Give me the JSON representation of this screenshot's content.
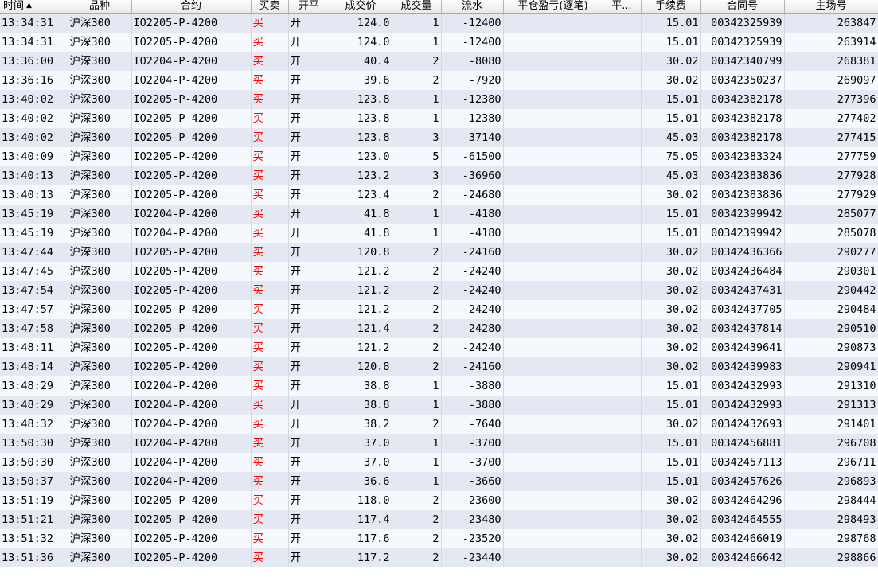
{
  "columns": [
    {
      "key": "time",
      "label": "时间",
      "sort_icon": "▲"
    },
    {
      "key": "product",
      "label": "品种"
    },
    {
      "key": "contract",
      "label": "合约"
    },
    {
      "key": "side",
      "label": "买卖"
    },
    {
      "key": "openclose",
      "label": "开平"
    },
    {
      "key": "price",
      "label": "成交价"
    },
    {
      "key": "volume",
      "label": "成交量"
    },
    {
      "key": "cash",
      "label": "流水"
    },
    {
      "key": "pnl",
      "label": "平仓盈亏(逐笔)"
    },
    {
      "key": "ph",
      "label": "平..."
    },
    {
      "key": "fee",
      "label": "手续费"
    },
    {
      "key": "order",
      "label": "合同号"
    },
    {
      "key": "deal",
      "label": "主场号"
    }
  ],
  "colors": {
    "buy": "#ff0000",
    "cashflow_negative": "#008a00",
    "row_odd": "#e4e8f3",
    "row_even": "#f5f8fd"
  },
  "rows": [
    {
      "time": "13:34:31",
      "product": "沪深300",
      "contract": "IO2205-P-4200",
      "side": "买",
      "openclose": "开",
      "price": "124.0",
      "volume": "1",
      "cash": "-12400",
      "pnl": "",
      "ph": "",
      "fee": "15.01",
      "order": "00342325939",
      "deal": "263847"
    },
    {
      "time": "13:34:31",
      "product": "沪深300",
      "contract": "IO2205-P-4200",
      "side": "买",
      "openclose": "开",
      "price": "124.0",
      "volume": "1",
      "cash": "-12400",
      "pnl": "",
      "ph": "",
      "fee": "15.01",
      "order": "00342325939",
      "deal": "263914"
    },
    {
      "time": "13:36:00",
      "product": "沪深300",
      "contract": "IO2204-P-4200",
      "side": "买",
      "openclose": "开",
      "price": "40.4",
      "volume": "2",
      "cash": "-8080",
      "pnl": "",
      "ph": "",
      "fee": "30.02",
      "order": "00342340799",
      "deal": "268381"
    },
    {
      "time": "13:36:16",
      "product": "沪深300",
      "contract": "IO2204-P-4200",
      "side": "买",
      "openclose": "开",
      "price": "39.6",
      "volume": "2",
      "cash": "-7920",
      "pnl": "",
      "ph": "",
      "fee": "30.02",
      "order": "00342350237",
      "deal": "269097"
    },
    {
      "time": "13:40:02",
      "product": "沪深300",
      "contract": "IO2205-P-4200",
      "side": "买",
      "openclose": "开",
      "price": "123.8",
      "volume": "1",
      "cash": "-12380",
      "pnl": "",
      "ph": "",
      "fee": "15.01",
      "order": "00342382178",
      "deal": "277396"
    },
    {
      "time": "13:40:02",
      "product": "沪深300",
      "contract": "IO2205-P-4200",
      "side": "买",
      "openclose": "开",
      "price": "123.8",
      "volume": "1",
      "cash": "-12380",
      "pnl": "",
      "ph": "",
      "fee": "15.01",
      "order": "00342382178",
      "deal": "277402"
    },
    {
      "time": "13:40:02",
      "product": "沪深300",
      "contract": "IO2205-P-4200",
      "side": "买",
      "openclose": "开",
      "price": "123.8",
      "volume": "3",
      "cash": "-37140",
      "pnl": "",
      "ph": "",
      "fee": "45.03",
      "order": "00342382178",
      "deal": "277415"
    },
    {
      "time": "13:40:09",
      "product": "沪深300",
      "contract": "IO2205-P-4200",
      "side": "买",
      "openclose": "开",
      "price": "123.0",
      "volume": "5",
      "cash": "-61500",
      "pnl": "",
      "ph": "",
      "fee": "75.05",
      "order": "00342383324",
      "deal": "277759"
    },
    {
      "time": "13:40:13",
      "product": "沪深300",
      "contract": "IO2205-P-4200",
      "side": "买",
      "openclose": "开",
      "price": "123.2",
      "volume": "3",
      "cash": "-36960",
      "pnl": "",
      "ph": "",
      "fee": "45.03",
      "order": "00342383836",
      "deal": "277928"
    },
    {
      "time": "13:40:13",
      "product": "沪深300",
      "contract": "IO2205-P-4200",
      "side": "买",
      "openclose": "开",
      "price": "123.4",
      "volume": "2",
      "cash": "-24680",
      "pnl": "",
      "ph": "",
      "fee": "30.02",
      "order": "00342383836",
      "deal": "277929"
    },
    {
      "time": "13:45:19",
      "product": "沪深300",
      "contract": "IO2204-P-4200",
      "side": "买",
      "openclose": "开",
      "price": "41.8",
      "volume": "1",
      "cash": "-4180",
      "pnl": "",
      "ph": "",
      "fee": "15.01",
      "order": "00342399942",
      "deal": "285077"
    },
    {
      "time": "13:45:19",
      "product": "沪深300",
      "contract": "IO2204-P-4200",
      "side": "买",
      "openclose": "开",
      "price": "41.8",
      "volume": "1",
      "cash": "-4180",
      "pnl": "",
      "ph": "",
      "fee": "15.01",
      "order": "00342399942",
      "deal": "285078"
    },
    {
      "time": "13:47:44",
      "product": "沪深300",
      "contract": "IO2205-P-4200",
      "side": "买",
      "openclose": "开",
      "price": "120.8",
      "volume": "2",
      "cash": "-24160",
      "pnl": "",
      "ph": "",
      "fee": "30.02",
      "order": "00342436366",
      "deal": "290277"
    },
    {
      "time": "13:47:45",
      "product": "沪深300",
      "contract": "IO2205-P-4200",
      "side": "买",
      "openclose": "开",
      "price": "121.2",
      "volume": "2",
      "cash": "-24240",
      "pnl": "",
      "ph": "",
      "fee": "30.02",
      "order": "00342436484",
      "deal": "290301"
    },
    {
      "time": "13:47:54",
      "product": "沪深300",
      "contract": "IO2205-P-4200",
      "side": "买",
      "openclose": "开",
      "price": "121.2",
      "volume": "2",
      "cash": "-24240",
      "pnl": "",
      "ph": "",
      "fee": "30.02",
      "order": "00342437431",
      "deal": "290442"
    },
    {
      "time": "13:47:57",
      "product": "沪深300",
      "contract": "IO2205-P-4200",
      "side": "买",
      "openclose": "开",
      "price": "121.2",
      "volume": "2",
      "cash": "-24240",
      "pnl": "",
      "ph": "",
      "fee": "30.02",
      "order": "00342437705",
      "deal": "290484"
    },
    {
      "time": "13:47:58",
      "product": "沪深300",
      "contract": "IO2205-P-4200",
      "side": "买",
      "openclose": "开",
      "price": "121.4",
      "volume": "2",
      "cash": "-24280",
      "pnl": "",
      "ph": "",
      "fee": "30.02",
      "order": "00342437814",
      "deal": "290510"
    },
    {
      "time": "13:48:11",
      "product": "沪深300",
      "contract": "IO2205-P-4200",
      "side": "买",
      "openclose": "开",
      "price": "121.2",
      "volume": "2",
      "cash": "-24240",
      "pnl": "",
      "ph": "",
      "fee": "30.02",
      "order": "00342439641",
      "deal": "290873"
    },
    {
      "time": "13:48:14",
      "product": "沪深300",
      "contract": "IO2205-P-4200",
      "side": "买",
      "openclose": "开",
      "price": "120.8",
      "volume": "2",
      "cash": "-24160",
      "pnl": "",
      "ph": "",
      "fee": "30.02",
      "order": "00342439983",
      "deal": "290941"
    },
    {
      "time": "13:48:29",
      "product": "沪深300",
      "contract": "IO2204-P-4200",
      "side": "买",
      "openclose": "开",
      "price": "38.8",
      "volume": "1",
      "cash": "-3880",
      "pnl": "",
      "ph": "",
      "fee": "15.01",
      "order": "00342432993",
      "deal": "291310"
    },
    {
      "time": "13:48:29",
      "product": "沪深300",
      "contract": "IO2204-P-4200",
      "side": "买",
      "openclose": "开",
      "price": "38.8",
      "volume": "1",
      "cash": "-3880",
      "pnl": "",
      "ph": "",
      "fee": "15.01",
      "order": "00342432993",
      "deal": "291313"
    },
    {
      "time": "13:48:32",
      "product": "沪深300",
      "contract": "IO2204-P-4200",
      "side": "买",
      "openclose": "开",
      "price": "38.2",
      "volume": "2",
      "cash": "-7640",
      "pnl": "",
      "ph": "",
      "fee": "30.02",
      "order": "00342432693",
      "deal": "291401"
    },
    {
      "time": "13:50:30",
      "product": "沪深300",
      "contract": "IO2204-P-4200",
      "side": "买",
      "openclose": "开",
      "price": "37.0",
      "volume": "1",
      "cash": "-3700",
      "pnl": "",
      "ph": "",
      "fee": "15.01",
      "order": "00342456881",
      "deal": "296708"
    },
    {
      "time": "13:50:30",
      "product": "沪深300",
      "contract": "IO2204-P-4200",
      "side": "买",
      "openclose": "开",
      "price": "37.0",
      "volume": "1",
      "cash": "-3700",
      "pnl": "",
      "ph": "",
      "fee": "15.01",
      "order": "00342457113",
      "deal": "296711"
    },
    {
      "time": "13:50:37",
      "product": "沪深300",
      "contract": "IO2204-P-4200",
      "side": "买",
      "openclose": "开",
      "price": "36.6",
      "volume": "1",
      "cash": "-3660",
      "pnl": "",
      "ph": "",
      "fee": "15.01",
      "order": "00342457626",
      "deal": "296893"
    },
    {
      "time": "13:51:19",
      "product": "沪深300",
      "contract": "IO2205-P-4200",
      "side": "买",
      "openclose": "开",
      "price": "118.0",
      "volume": "2",
      "cash": "-23600",
      "pnl": "",
      "ph": "",
      "fee": "30.02",
      "order": "00342464296",
      "deal": "298444"
    },
    {
      "time": "13:51:21",
      "product": "沪深300",
      "contract": "IO2205-P-4200",
      "side": "买",
      "openclose": "开",
      "price": "117.4",
      "volume": "2",
      "cash": "-23480",
      "pnl": "",
      "ph": "",
      "fee": "30.02",
      "order": "00342464555",
      "deal": "298493"
    },
    {
      "time": "13:51:32",
      "product": "沪深300",
      "contract": "IO2205-P-4200",
      "side": "买",
      "openclose": "开",
      "price": "117.6",
      "volume": "2",
      "cash": "-23520",
      "pnl": "",
      "ph": "",
      "fee": "30.02",
      "order": "00342466019",
      "deal": "298768"
    },
    {
      "time": "13:51:36",
      "product": "沪深300",
      "contract": "IO2205-P-4200",
      "side": "买",
      "openclose": "开",
      "price": "117.2",
      "volume": "2",
      "cash": "-23440",
      "pnl": "",
      "ph": "",
      "fee": "30.02",
      "order": "00342466642",
      "deal": "298866"
    }
  ]
}
